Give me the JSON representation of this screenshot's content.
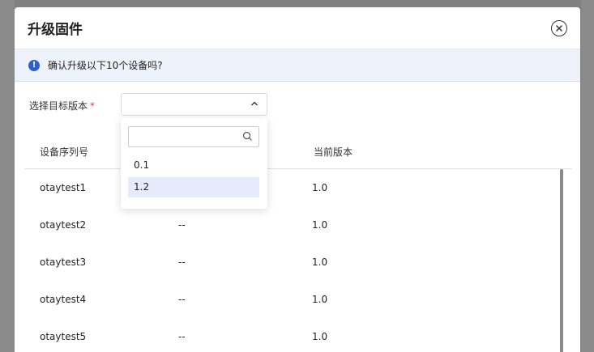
{
  "modal": {
    "title": "升级固件",
    "alert_text": "确认升级以下10个设备吗?",
    "alert_icon": "!"
  },
  "form": {
    "target_version_label": "选择目标版本",
    "required_mark": "*",
    "selected_value": ""
  },
  "dropdown": {
    "search_placeholder": "",
    "options": [
      "0.1",
      "1.2"
    ],
    "highlighted_option": "1.2"
  },
  "table": {
    "headers": [
      "设备序列号",
      "",
      "当前版本"
    ],
    "rows": [
      [
        "otaytest1",
        "",
        "1.0"
      ],
      [
        "otaytest2",
        "--",
        "1.0"
      ],
      [
        "otaytest3",
        "--",
        "1.0"
      ],
      [
        "otaytest4",
        "--",
        "1.0"
      ],
      [
        "otaytest5",
        "--",
        "1.0"
      ]
    ]
  },
  "colors": {
    "accent": "#2f5fd0",
    "alert_bg": "#eef2fb",
    "highlight_bg": "#e6ebfb",
    "required": "#e04040"
  },
  "icons": {
    "close": "close-circle-icon",
    "info": "info-icon",
    "caret": "chevron-up-icon",
    "search": "search-icon"
  }
}
